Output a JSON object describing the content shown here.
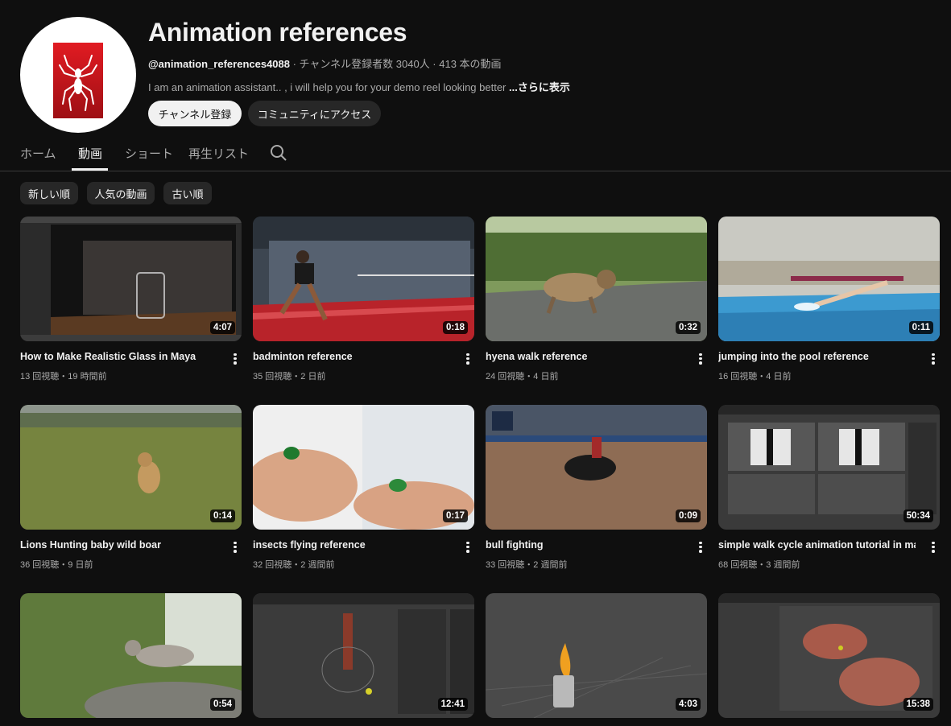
{
  "channel": {
    "name": "Animation references",
    "handle": "@animation_references4088",
    "meta": " · チャンネル登録者数 3040人 · 413 本の動画",
    "description": "I am an animation assistant.. , i will help you for your demo reel  looking better ",
    "more_label": "...さらに表示",
    "subscribe_label": "チャンネル登録",
    "community_label": "コミュニティにアクセス",
    "avatar_icon": "spider-logo-icon"
  },
  "tabs": [
    {
      "label": "ホーム"
    },
    {
      "label": "動画"
    },
    {
      "label": "ショート"
    },
    {
      "label": "再生リスト"
    }
  ],
  "filters": [
    {
      "label": "新しい順"
    },
    {
      "label": "人気の動画"
    },
    {
      "label": "古い順"
    }
  ],
  "videos": [
    {
      "title": "How to Make Realistic Glass in Maya",
      "meta": "13 回視聴・19 時間前",
      "duration": "4:07"
    },
    {
      "title": "badminton reference",
      "meta": "35 回視聴・2 日前",
      "duration": "0:18"
    },
    {
      "title": "hyena walk reference",
      "meta": "24 回視聴・4 日前",
      "duration": "0:32"
    },
    {
      "title": "jumping into the pool reference",
      "meta": "16 回視聴・4 日前",
      "duration": "0:11"
    },
    {
      "title": "Lions Hunting baby wild boar",
      "meta": "36 回視聴・9 日前",
      "duration": "0:14"
    },
    {
      "title": "insects flying reference",
      "meta": "32 回視聴・2 週間前",
      "duration": "0:17"
    },
    {
      "title": "bull fighting",
      "meta": "33 回視聴・2 週間前",
      "duration": "0:09"
    },
    {
      "title": "simple walk cycle animation tutorial in maya",
      "meta": "68 回視聴・3 週間前",
      "duration": "50:34"
    },
    {
      "title": "",
      "meta": "",
      "duration": "0:54"
    },
    {
      "title": "",
      "meta": "",
      "duration": "12:41"
    },
    {
      "title": "",
      "meta": "",
      "duration": "4:03"
    },
    {
      "title": "",
      "meta": "",
      "duration": "15:38"
    }
  ],
  "colors": {
    "background": "#0f0f0f",
    "text": "#f1f1f1",
    "secondary_text": "#aaaaaa",
    "chip": "#272727",
    "avatar_red": "#c8161d"
  }
}
